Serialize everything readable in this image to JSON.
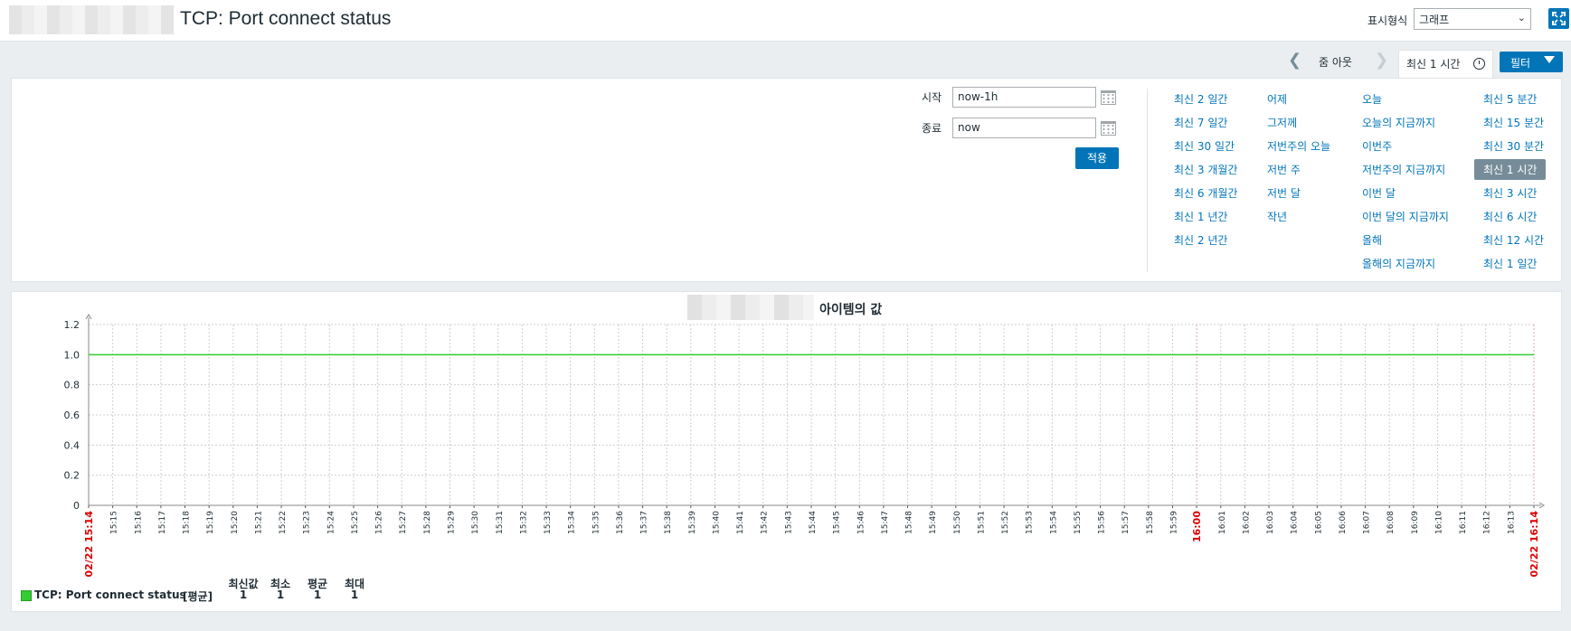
{
  "header": {
    "title": "TCP: Port connect status",
    "view_label": "표시형식",
    "view_value": "그래프"
  },
  "tabs": {
    "zoom_out": "줌 아웃",
    "time_tab": "최신 1 시간",
    "filter": "필터"
  },
  "filter": {
    "from_label": "시작",
    "from_value": "now-1h",
    "to_label": "종료",
    "to_value": "now",
    "apply": "적용",
    "quick": [
      [
        "최신 2 일간",
        "최신 7 일간",
        "최신 30 일간",
        "최신 3 개월간",
        "최신 6 개월간",
        "최신 1 년간",
        "최신 2 년간"
      ],
      [
        "어제",
        "그저께",
        "저번주의 오늘",
        "저번 주",
        "저번 달",
        "작년"
      ],
      [
        "오늘",
        "오늘의 지금까지",
        "이번주",
        "저번주의 지금까지",
        "이번 달",
        "이번 달의 지금까지",
        "올해",
        "올해의 지금까지"
      ],
      [
        "최신 5 분간",
        "최신 15 분간",
        "최신 30 분간",
        "최신 1 시간",
        "최신 3 시간",
        "최신 6 시간",
        "최신 12 시간",
        "최신 1 일간"
      ]
    ],
    "active_quick": "최신 1 시간"
  },
  "graph": {
    "title": "아이템의 값",
    "legend": {
      "name": "TCP: Port connect status",
      "func": "[평균]",
      "headers": [
        "최신값",
        "최소",
        "평균",
        "최대"
      ],
      "values": [
        "1",
        "1",
        "1",
        "1"
      ]
    }
  },
  "chart_data": {
    "type": "line",
    "title": "아이템의 값",
    "ylim": [
      0,
      1.2
    ],
    "y_ticks": [
      "0",
      "0.2",
      "0.4",
      "0.6",
      "0.8",
      "1.0",
      "1.2"
    ],
    "x_ticks": [
      "02/22 15:14",
      "15:15",
      "15:16",
      "15:17",
      "15:18",
      "15:19",
      "15:20",
      "15:21",
      "15:22",
      "15:23",
      "15:24",
      "15:25",
      "15:26",
      "15:27",
      "15:28",
      "15:29",
      "15:30",
      "15:31",
      "15:32",
      "15:33",
      "15:34",
      "15:35",
      "15:36",
      "15:37",
      "15:38",
      "15:39",
      "15:40",
      "15:41",
      "15:42",
      "15:43",
      "15:44",
      "15:45",
      "15:46",
      "15:47",
      "15:48",
      "15:49",
      "15:50",
      "15:51",
      "15:52",
      "15:53",
      "15:54",
      "15:55",
      "15:56",
      "15:57",
      "15:58",
      "15:59",
      "16:00",
      "16:01",
      "16:02",
      "16:03",
      "16:04",
      "16:05",
      "16:06",
      "16:07",
      "16:08",
      "16:09",
      "16:10",
      "16:11",
      "16:12",
      "16:13",
      "02/22 16:14"
    ],
    "highlight_ticks": [
      "02/22 15:14",
      "16:00",
      "02/22 16:14"
    ],
    "series": [
      {
        "name": "TCP: Port connect status",
        "x": [
          "02/22 15:14",
          "02/22 16:14"
        ],
        "values": [
          1,
          1
        ],
        "color": "#33cc33"
      }
    ],
    "grid": true,
    "accent_color": "#dc0000"
  }
}
